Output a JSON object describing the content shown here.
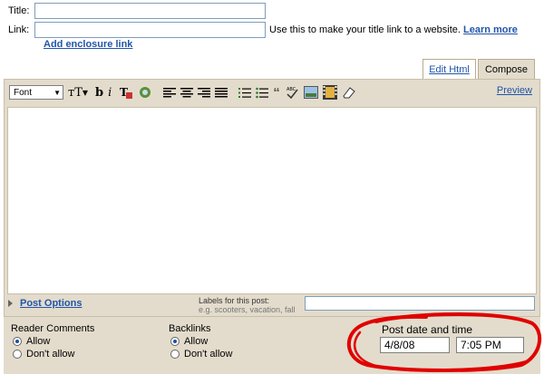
{
  "form": {
    "title_label": "Title:",
    "title_value": "",
    "link_label": "Link:",
    "link_value": "",
    "link_hint": "Use this to make your title link to a website.",
    "learn_more": "Learn more",
    "add_enclosure": "Add enclosure link"
  },
  "tabs": [
    {
      "label": "Edit Html",
      "active": false
    },
    {
      "label": "Compose",
      "active": true
    }
  ],
  "toolbar": {
    "font_select": "Font",
    "preview": "Preview"
  },
  "post_options": {
    "label": "Post Options",
    "labels_title": "Labels for this post:",
    "labels_hint": "e.g. scooters, vacation, fall",
    "labels_value": ""
  },
  "reader_comments": {
    "title": "Reader Comments",
    "options": [
      "Allow",
      "Don't allow"
    ],
    "selected": "Allow"
  },
  "backlinks": {
    "title": "Backlinks",
    "options": [
      "Allow",
      "Don't allow"
    ],
    "selected": "Allow"
  },
  "post_date": {
    "title": "Post date and time",
    "date": "4/8/08",
    "time": "7:05 PM"
  },
  "colors": {
    "panel": "#e3dccc",
    "link": "#2255aa",
    "highlight_circle": "#e00000"
  }
}
